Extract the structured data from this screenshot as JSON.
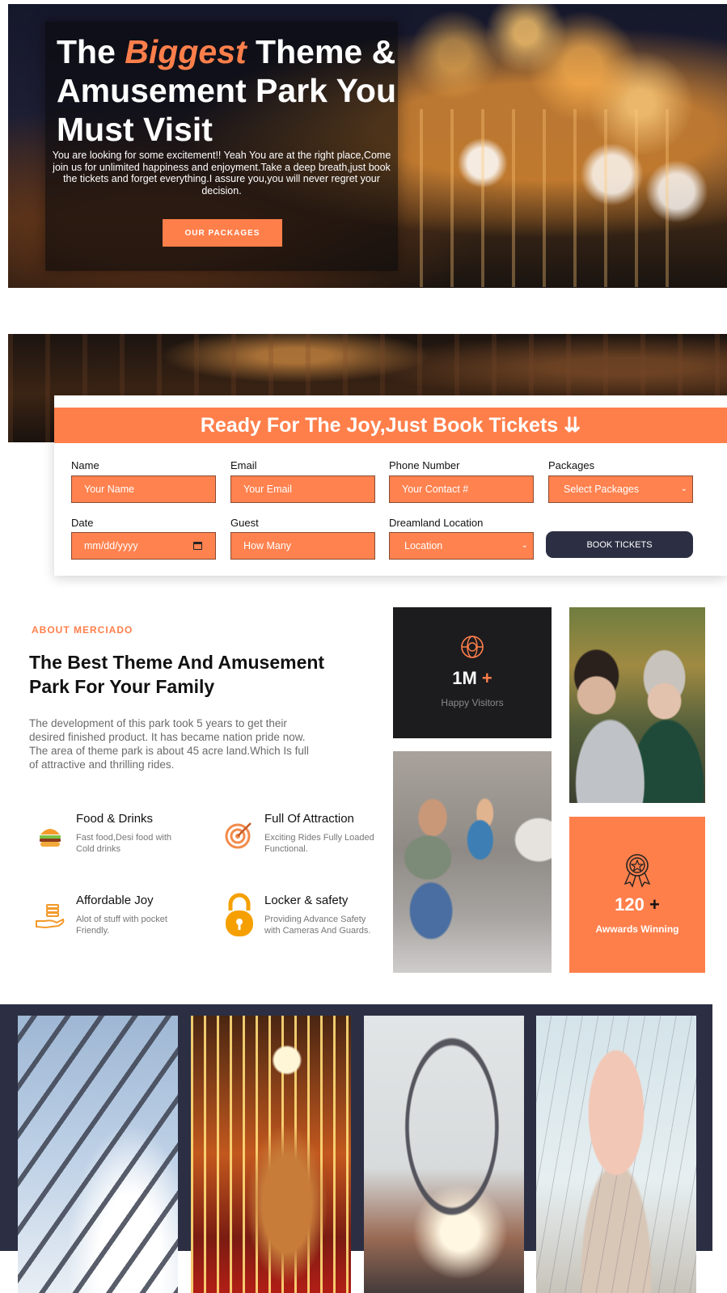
{
  "hero": {
    "title_pre": "The ",
    "title_accent": "Biggest",
    "title_post": " Theme & Amusement Park You Must Visit",
    "description": "You are looking for some excitement!! Yeah You are at the right place,Come join us for unlimited happiness and enjoyment.Take a deep breath,just book the tickets and forget everything.I assure you,you will never regret your decision.",
    "button_label": "OUR PACKAGES"
  },
  "booking": {
    "header": "Ready For The Joy,Just Book Tickets ⇊",
    "fields": {
      "name": {
        "label": "Name",
        "placeholder": "Your Name"
      },
      "email": {
        "label": "Email",
        "placeholder": "Your Email"
      },
      "phone": {
        "label": "Phone Number",
        "placeholder": "Your Contact #"
      },
      "packages": {
        "label": "Packages",
        "value": "Select Packages"
      },
      "date": {
        "label": "Date",
        "placeholder": "mm/dd/yyyy"
      },
      "guest": {
        "label": "Guest",
        "placeholder": "How Many"
      },
      "location": {
        "label": "Dreamland Location",
        "value": "Location"
      }
    },
    "button_label": "BOOK TICKETS"
  },
  "about": {
    "eyebrow": "ABOUT MERCIADO",
    "title": "The Best Theme And Amusement Park For Your Family",
    "text": "The development of this park took 5 years to get their desired finished product. It has became nation pride now. The area of theme park is about 45 acre land.Which Is full of attractive and thrilling rides.",
    "features": [
      {
        "title": "Food & Drinks",
        "desc": "Fast food,Desi food with Cold drinks",
        "icon": "burger-icon"
      },
      {
        "title": "Full Of Attraction",
        "desc": "Exciting Rides Fully Loaded Functional.",
        "icon": "target-icon"
      },
      {
        "title": "Affordable Joy",
        "desc": "Alot of stuff with pocket Friendly.",
        "icon": "money-hand-icon"
      },
      {
        "title": "Locker & safety",
        "desc": "Providing Advance Safety with Cameras And Guards.",
        "icon": "lock-icon"
      }
    ]
  },
  "stats": {
    "visitors": {
      "value": "1M",
      "plus": "+",
      "label": "Happy Visitors",
      "icon": "globe-icon"
    },
    "awards": {
      "value": "120",
      "plus": "+",
      "label": "Awwards Winning",
      "icon": "award-icon"
    }
  },
  "colors": {
    "accent": "#ff7f4b",
    "dark": "#2c2f43",
    "card_dark": "#1c1c1e"
  }
}
